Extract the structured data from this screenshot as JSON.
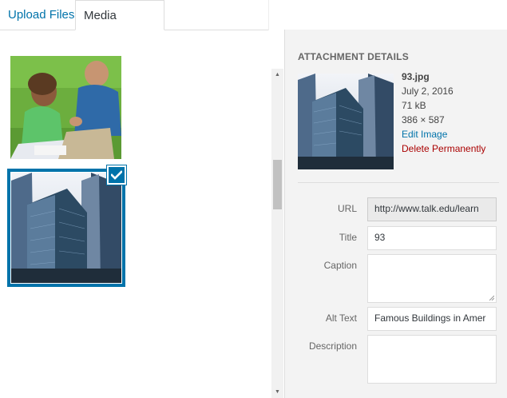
{
  "tabs": {
    "upload": "Upload Files",
    "library": "Media Library"
  },
  "gallery": {
    "items": [
      {
        "name": "students-on-grass-photo",
        "selected": false
      },
      {
        "name": "office-building-photo",
        "selected": true
      }
    ]
  },
  "details": {
    "heading": "ATTACHMENT DETAILS",
    "filename": "93.jpg",
    "date": "July 2, 2016",
    "size": "71 kB",
    "dimensions": "386 × 587",
    "edit_link": "Edit Image",
    "delete_link": "Delete Permanently"
  },
  "form": {
    "url_label": "URL",
    "url_value": "http://www.talk.edu/learn",
    "title_label": "Title",
    "title_value": "93",
    "caption_label": "Caption",
    "caption_value": "",
    "alt_label": "Alt Text",
    "alt_value": "Famous Buildings in Amer",
    "description_label": "Description",
    "description_value": ""
  },
  "colors": {
    "accent": "#0073aa",
    "danger": "#a00000",
    "sidebar_bg": "#f3f3f3"
  }
}
